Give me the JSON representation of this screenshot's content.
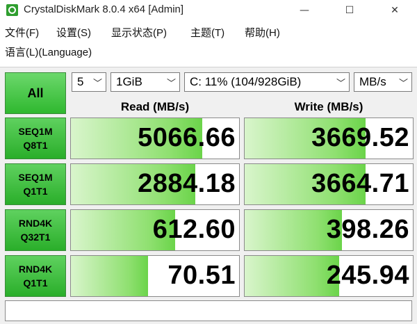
{
  "window": {
    "title": "CrystalDiskMark 8.0.4 x64 [Admin]",
    "min": "—",
    "max": "☐",
    "close": "✕"
  },
  "menu": [
    "文件(F)",
    "设置(S)",
    "显示状态(P)",
    "主题(T)",
    "帮助(H)"
  ],
  "menu2": [
    "语言(L)(Language)"
  ],
  "controls": {
    "all_label": "All",
    "count": "5",
    "size": "1GiB",
    "drive": "C: 11% (104/928GiB)",
    "unit": "MB/s"
  },
  "headers": {
    "read": "Read (MB/s)",
    "write": "Write (MB/s)"
  },
  "rows": [
    {
      "line1": "SEQ1M",
      "line2": "Q8T1",
      "read": "5066.66",
      "write": "3669.52",
      "read_fill": 0.78,
      "write_fill": 0.72
    },
    {
      "line1": "SEQ1M",
      "line2": "Q1T1",
      "read": "2884.18",
      "write": "3664.71",
      "read_fill": 0.74,
      "write_fill": 0.72
    },
    {
      "line1": "RND4K",
      "line2": "Q32T1",
      "read": "612.60",
      "write": "398.26",
      "read_fill": 0.62,
      "write_fill": 0.58
    },
    {
      "line1": "RND4K",
      "line2": "Q1T1",
      "read": "70.51",
      "write": "245.94",
      "read_fill": 0.46,
      "write_fill": 0.56
    }
  ],
  "status": ""
}
